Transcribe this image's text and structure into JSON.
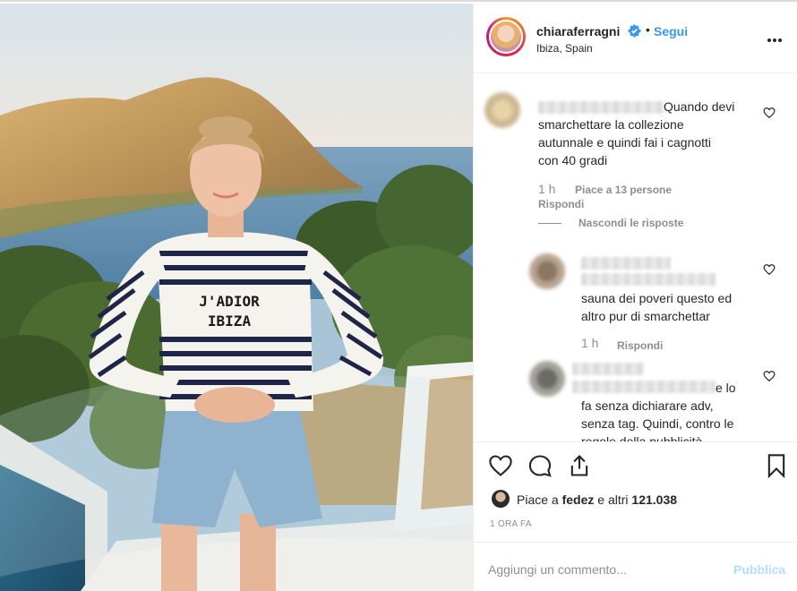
{
  "header": {
    "username": "chiaraferragni",
    "separator": "•",
    "follow_label": "Segui",
    "location": "Ibiza, Spain"
  },
  "photo": {
    "sweater_text_line1": "J'ADIOR",
    "sweater_text_line2": "IBIZA"
  },
  "comments": [
    {
      "lines": [
        "Quando devi",
        "smarchettare la collezione",
        "autunnale e quindi fai i cagnotti",
        "con 40 gradi"
      ],
      "time": "1 h",
      "likes": "Piace a 13 persone",
      "reply": "Rispondi"
    }
  ],
  "hide_replies_label": "Nascondi le risposte",
  "replies": [
    {
      "lines": [
        "sauna dei poveri questo ed",
        "altro pur di smarchettar"
      ],
      "time": "1 h",
      "reply": "Rispondi"
    },
    {
      "lines": [
        "e lo",
        "fa senza dichiarare adv,",
        "senza tag. Quindi, contro le",
        "regole della pubblicità"
      ]
    }
  ],
  "likes": {
    "prefix": "Piace a ",
    "user": "fedez",
    "suffix": " e altri ",
    "count": "121.038"
  },
  "post_time": "1 ORA FA",
  "add_comment": {
    "placeholder": "Aggiungi un commento...",
    "publish_label": "Pubblica"
  },
  "colors": {
    "accent": "#3897f0",
    "publish_disabled": "#b2dffc",
    "muted": "#8e8e8e"
  },
  "icons": [
    "heart-icon",
    "comment-icon",
    "share-icon",
    "bookmark-icon",
    "verified-badge-icon",
    "more-options-icon"
  ]
}
